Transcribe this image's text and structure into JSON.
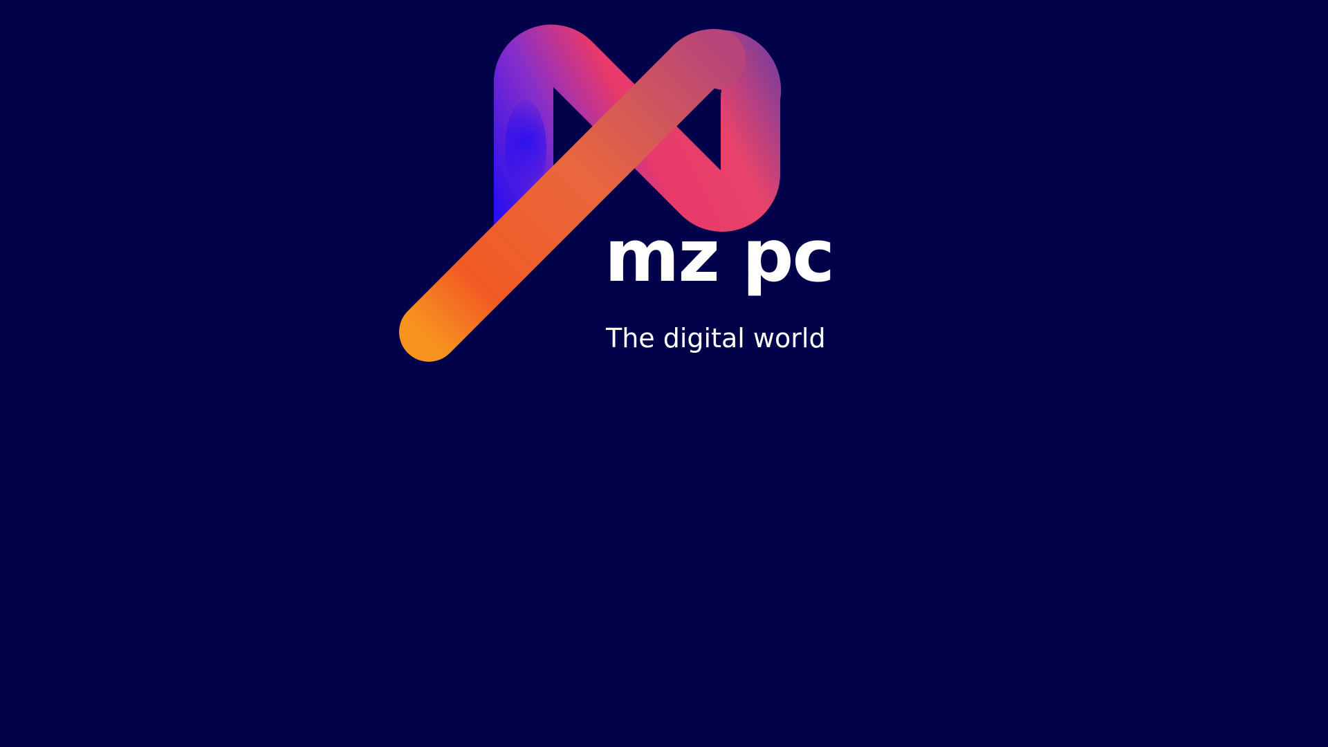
{
  "splash": {
    "brand_name": "mz pc",
    "tagline": "The digital world",
    "logo_icon": "infinity-ribbon-logo-icon"
  },
  "colors": {
    "background": "#02024a",
    "text": "#ffffff",
    "ribbon_orange": "#f7931e",
    "ribbon_orange_deep": "#f15a24",
    "ribbon_pink": "#e8396b",
    "ribbon_magenta": "#c2378f",
    "ribbon_purple": "#7a3d9c",
    "ribbon_blue": "#2a0ff0"
  }
}
